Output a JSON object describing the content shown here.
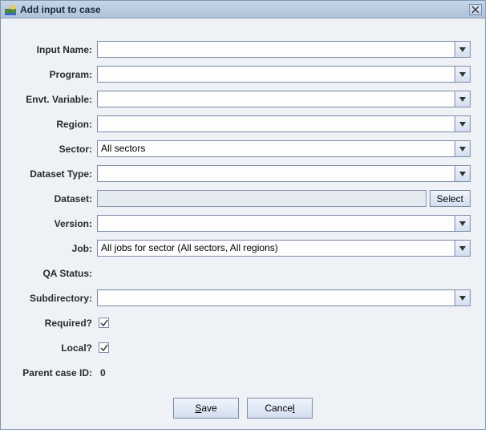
{
  "window": {
    "title": "Add input to case"
  },
  "form": {
    "input_name": {
      "label": "Input Name:",
      "value": ""
    },
    "program": {
      "label": "Program:",
      "value": ""
    },
    "envt_var": {
      "label": "Envt. Variable:",
      "value": ""
    },
    "region": {
      "label": "Region:",
      "value": ""
    },
    "sector": {
      "label": "Sector:",
      "value": "All sectors"
    },
    "dataset_type": {
      "label": "Dataset Type:",
      "value": ""
    },
    "dataset": {
      "label": "Dataset:",
      "value": "",
      "select_label": "Select"
    },
    "version": {
      "label": "Version:",
      "value": ""
    },
    "job": {
      "label": "Job:",
      "value": "All jobs for sector (All sectors, All regions)"
    },
    "qa_status": {
      "label": "QA Status:",
      "value": ""
    },
    "subdirectory": {
      "label": "Subdirectory:",
      "value": ""
    },
    "required": {
      "label": "Required?",
      "checked": true
    },
    "local": {
      "label": "Local?",
      "checked": true
    },
    "parent_case_id": {
      "label": "Parent case ID:",
      "value": "0"
    }
  },
  "buttons": {
    "save": {
      "prefix": "",
      "mnemonic": "S",
      "suffix": "ave"
    },
    "cancel": {
      "prefix": "Cance",
      "mnemonic": "l",
      "suffix": ""
    }
  }
}
